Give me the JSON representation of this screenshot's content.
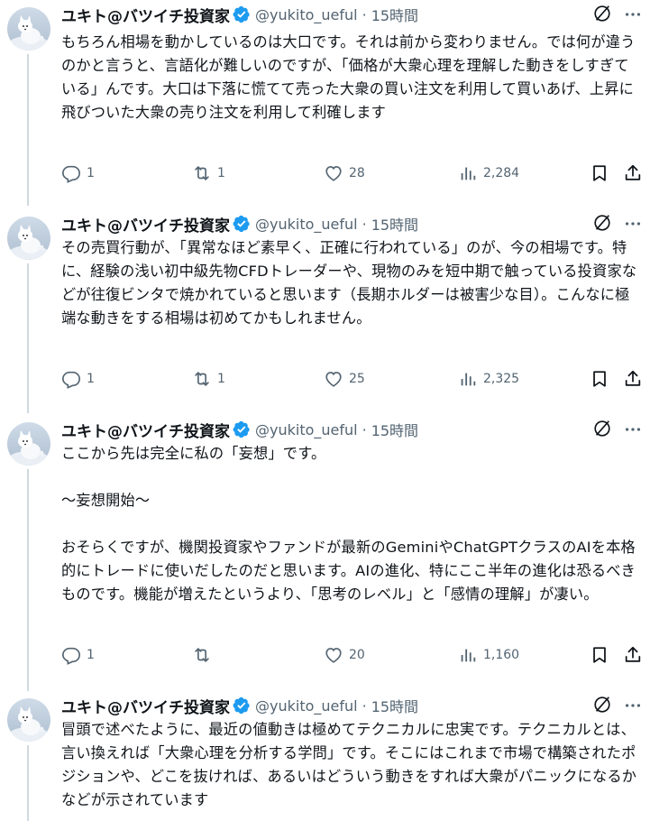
{
  "colors": {
    "text": "#0f1419",
    "secondary": "#536471",
    "verified": "#1d9bf0",
    "thread_line": "#cfd9de"
  },
  "tweets": [
    {
      "author": "ユキト@バツイチ投資家",
      "handle": "@yukito_ueful",
      "separator": "·",
      "time": "15時間",
      "text": "もちろん相場を動かしているのは大口です。それは前から変わりません。では何が違うのかと言うと、言語化が難しいのですが、「価格が大衆心理を理解した動きをしすぎている」んです。大口は下落に慌てて売った大衆の買い注文を利用して買いあげ、上昇に飛びついた大衆の売り注文を利用して利確します",
      "replies": "1",
      "retweets": "1",
      "likes": "28",
      "views": "2,284"
    },
    {
      "author": "ユキト@バツイチ投資家",
      "handle": "@yukito_ueful",
      "separator": "·",
      "time": "15時間",
      "text": "その売買行動が、「異常なほど素早く、正確に行われている」のが、今の相場です。特に、経験の浅い初中級先物CFDトレーダーや、現物のみを短中期で触っている投資家などが往復ビンタで焼かれていると思います（長期ホルダーは被害少な目）。こんなに極端な動きをする相場は初めてかもしれません。",
      "replies": "1",
      "retweets": "1",
      "likes": "25",
      "views": "2,325"
    },
    {
      "author": "ユキト@バツイチ投資家",
      "handle": "@yukito_ueful",
      "separator": "·",
      "time": "15時間",
      "text": "ここから先は完全に私の「妄想」です。\n\n～妄想開始～\n\nおそらくですが、機関投資家やファンドが最新のGeminiやChatGPTクラスのAIを本格的にトレードに使いだしたのだと思います。AIの進化、特にここ半年の進化は恐るべきものです。機能が増えたというより、「思考のレベル」と「感情の理解」が凄い。",
      "replies": "1",
      "retweets": "",
      "likes": "20",
      "views": "1,160"
    },
    {
      "author": "ユキト@バツイチ投資家",
      "handle": "@yukito_ueful",
      "separator": "·",
      "time": "15時間",
      "text": "冒頭で述べたように、最近の値動きは極めてテクニカルに忠実です。テクニカルとは、言い換えれば「大衆心理を分析する学問」です。そこにはこれまで市場で構築されたポジションや、どこを抜ければ、あるいはどういう動きをすれば大衆がパニックになるかなどが示されています"
    }
  ]
}
